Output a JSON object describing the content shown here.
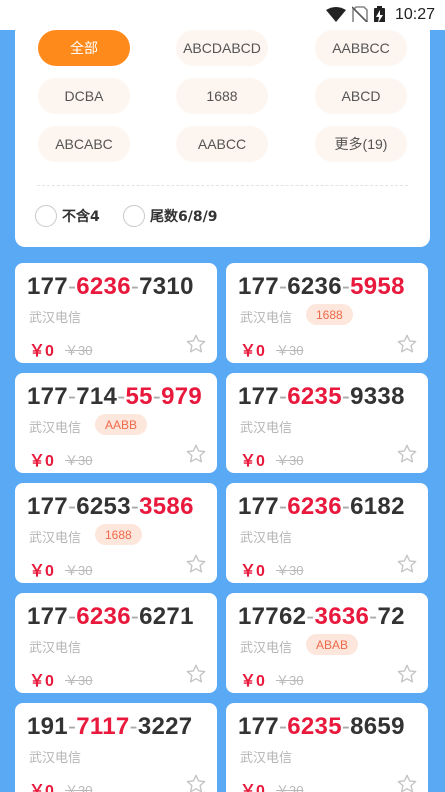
{
  "status_bar": {
    "time": "10:27"
  },
  "filters": {
    "tags": [
      {
        "label": "全部",
        "active": true
      },
      {
        "label": "ABCDABCD"
      },
      {
        "label": "AABBCC"
      },
      {
        "label": "DCBA"
      },
      {
        "label": "1688"
      },
      {
        "label": "ABCD"
      },
      {
        "label": "ABCABC"
      },
      {
        "label": "AABCC"
      },
      {
        "label": "更多(19)"
      }
    ],
    "options": [
      {
        "label": "不含4"
      },
      {
        "label": "尾数6/8/9"
      }
    ]
  },
  "colors": {
    "background": "#5aa9f5",
    "accent_orange": "#ff8a1c",
    "highlight_red": "#e8193c",
    "badge_bg": "#fde6dc",
    "badge_text": "#ee6a4a"
  },
  "icons": [
    "wifi-icon",
    "no-sim-icon",
    "battery-charging-icon",
    "star-outline-icon"
  ],
  "numbers": [
    {
      "parts": [
        "177",
        "6236",
        "7310"
      ],
      "highlight": [
        1
      ],
      "carrier": "武汉电信",
      "badge": "",
      "price": "￥0",
      "original": "￥30"
    },
    {
      "parts": [
        "177",
        "6236",
        "5958"
      ],
      "highlight": [
        2
      ],
      "carrier": "武汉电信",
      "badge": "1688",
      "price": "￥0",
      "original": "￥30"
    },
    {
      "parts": [
        "177",
        "714",
        "55",
        "979"
      ],
      "highlight": [
        2,
        3
      ],
      "carrier": "武汉电信",
      "badge": "AABB",
      "price": "￥0",
      "original": "￥30"
    },
    {
      "parts": [
        "177",
        "6235",
        "9338"
      ],
      "highlight": [
        1
      ],
      "carrier": "武汉电信",
      "badge": "",
      "price": "￥0",
      "original": "￥30"
    },
    {
      "parts": [
        "177",
        "6253",
        "3586"
      ],
      "highlight": [
        2
      ],
      "carrier": "武汉电信",
      "badge": "1688",
      "price": "￥0",
      "original": "￥30"
    },
    {
      "parts": [
        "177",
        "6236",
        "6182"
      ],
      "highlight": [
        1
      ],
      "carrier": "武汉电信",
      "badge": "",
      "price": "￥0",
      "original": "￥30"
    },
    {
      "parts": [
        "177",
        "6236",
        "6271"
      ],
      "highlight": [
        1
      ],
      "carrier": "武汉电信",
      "badge": "",
      "price": "￥0",
      "original": "￥30"
    },
    {
      "parts": [
        "17762",
        "3636",
        "72"
      ],
      "highlight": [
        1
      ],
      "carrier": "武汉电信",
      "badge": "ABAB",
      "price": "￥0",
      "original": "￥30"
    },
    {
      "parts": [
        "191",
        "7117",
        "3227"
      ],
      "highlight": [
        1
      ],
      "carrier": "武汉电信",
      "badge": "",
      "price": "￥0",
      "original": "￥30"
    },
    {
      "parts": [
        "177",
        "6235",
        "8659"
      ],
      "highlight": [
        1
      ],
      "carrier": "武汉电信",
      "badge": "",
      "price": "￥0",
      "original": "￥30"
    }
  ]
}
